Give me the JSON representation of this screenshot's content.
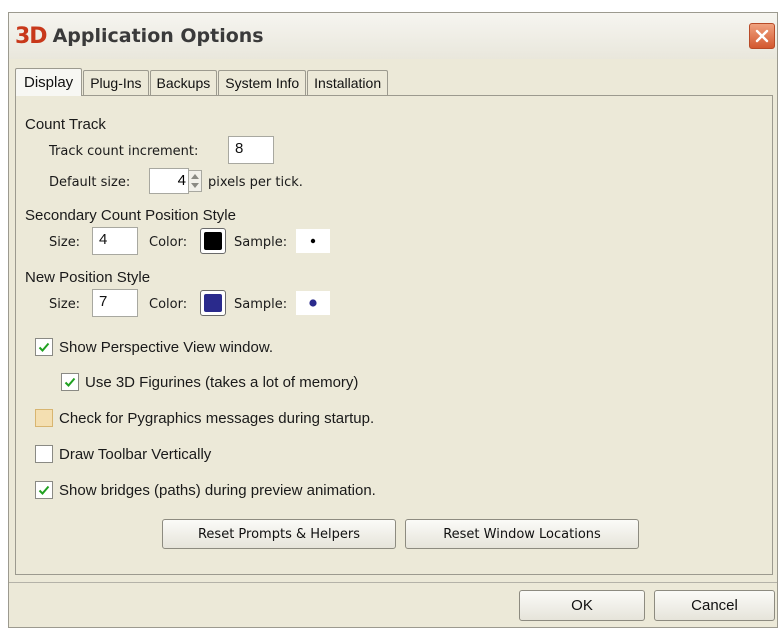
{
  "window": {
    "app_logo": "3D",
    "title": "Application Options"
  },
  "tabs": [
    {
      "label": "Display"
    },
    {
      "label": "Plug-Ins"
    },
    {
      "label": "Backups"
    },
    {
      "label": "System Info"
    },
    {
      "label": "Installation"
    }
  ],
  "count_track": {
    "title": "Count Track",
    "increment_label": "Track count increment:",
    "increment_value": "8",
    "default_size_label": "Default size:",
    "default_size_value": "4",
    "default_size_units": "pixels per tick."
  },
  "secondary_style": {
    "title": "Secondary Count Position Style",
    "size_label": "Size:",
    "size_value": "4",
    "color_label": "Color:",
    "color": "#000000",
    "sample_label": "Sample:"
  },
  "new_style": {
    "title": "New Position Style",
    "size_label": "Size:",
    "size_value": "7",
    "color_label": "Color:",
    "color": "#2a2a8c",
    "sample_label": "Sample:"
  },
  "options": [
    {
      "label": "Show Perspective View window.",
      "checked": true
    },
    {
      "label": "Use 3D Figurines (takes a lot of memory)",
      "checked": true
    },
    {
      "label": "Check for Pygraphics messages during startup.",
      "checked": false
    },
    {
      "label": "Draw Toolbar Vertically",
      "checked": false
    },
    {
      "label": "Show bridges (paths) during preview animation.",
      "checked": true
    }
  ],
  "buttons": {
    "reset_prompts": "Reset Prompts & Helpers",
    "reset_windows": "Reset Window Locations",
    "ok": "OK",
    "cancel": "Cancel"
  }
}
